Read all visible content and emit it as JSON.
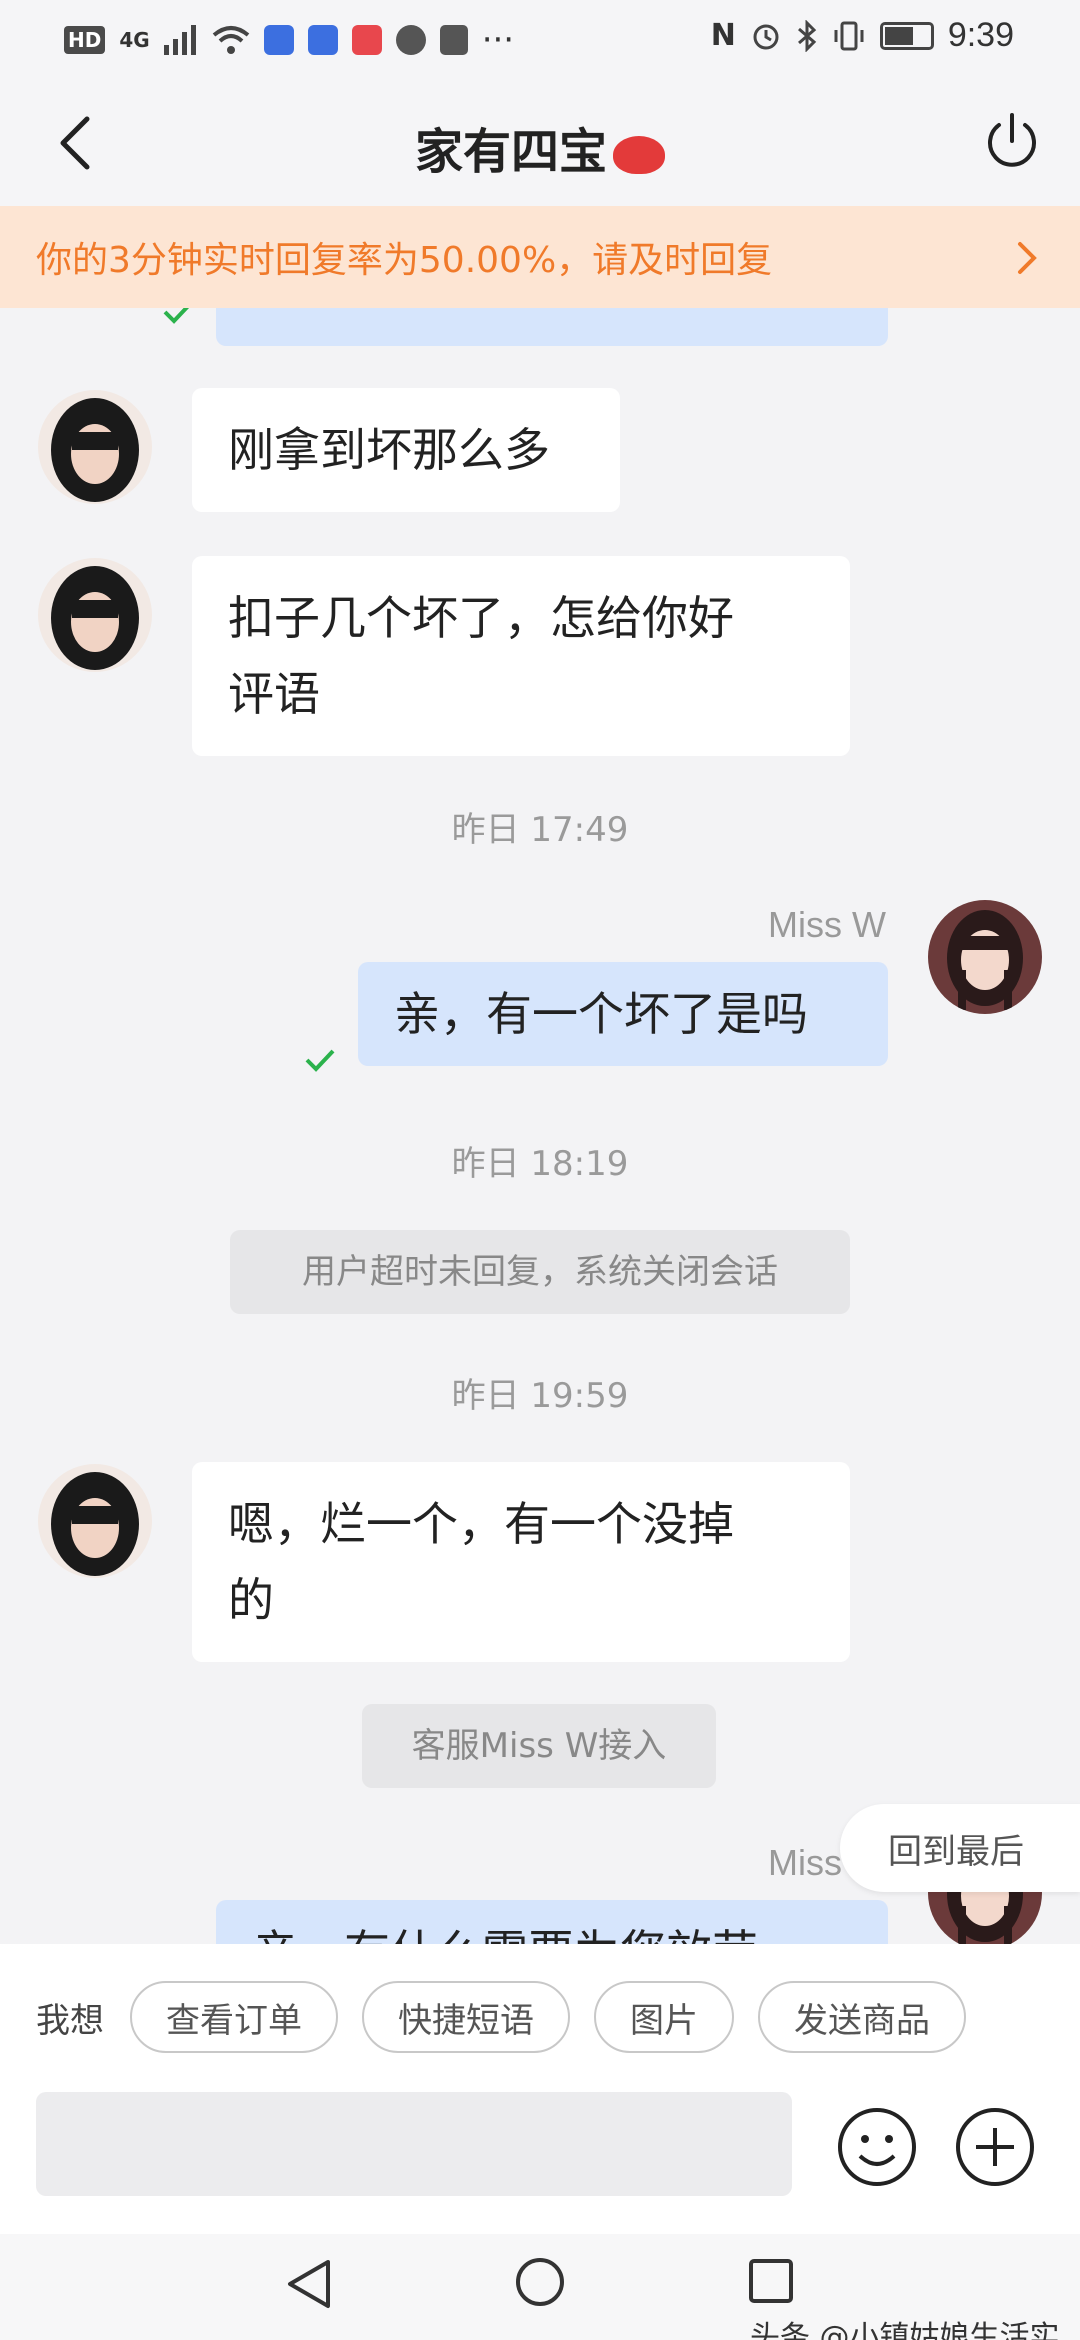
{
  "status_bar": {
    "hd": "HD",
    "network": "4G",
    "more": "···",
    "nfc": "N",
    "time": "9:39"
  },
  "header": {
    "title": "家有四宝",
    "back_icon": "chevron-left-icon",
    "power_icon": "power-icon"
  },
  "notice": {
    "text": "你的3分钟实时回复率为50.00%，请及时回复"
  },
  "messages": {
    "in1": "刚拿到坏那么多",
    "in2_line1": "扣子几个坏了，怎给你好",
    "in2_line2": "评语",
    "ts1": "昨日 17:49",
    "sender1": "Miss W",
    "out1": "亲，有一个坏了是吗",
    "ts2": "昨日 18:19",
    "sys1": "用户超时未回复，系统关闭会话",
    "ts3": "昨日 19:59",
    "in3_line1": "嗯，烂一个，有一个没掉",
    "in3_line2": "的",
    "sys2": "客服Miss W接入",
    "sender2": "Miss W",
    "out2_partial": "亲，有什么需要为您效劳"
  },
  "scroll_to_end": "回到最后",
  "toolbar": {
    "wish_label": "我想",
    "chips": [
      "查看订单",
      "快捷短语",
      "图片",
      "发送商品"
    ]
  },
  "watermark": "头条 @小镇姑娘生活实录",
  "colors": {
    "accent_orange": "#f07a2a",
    "notice_bg": "#fde5d3",
    "outgoing_bubble": "#d6e5fc",
    "read_check": "#2bb24c"
  }
}
